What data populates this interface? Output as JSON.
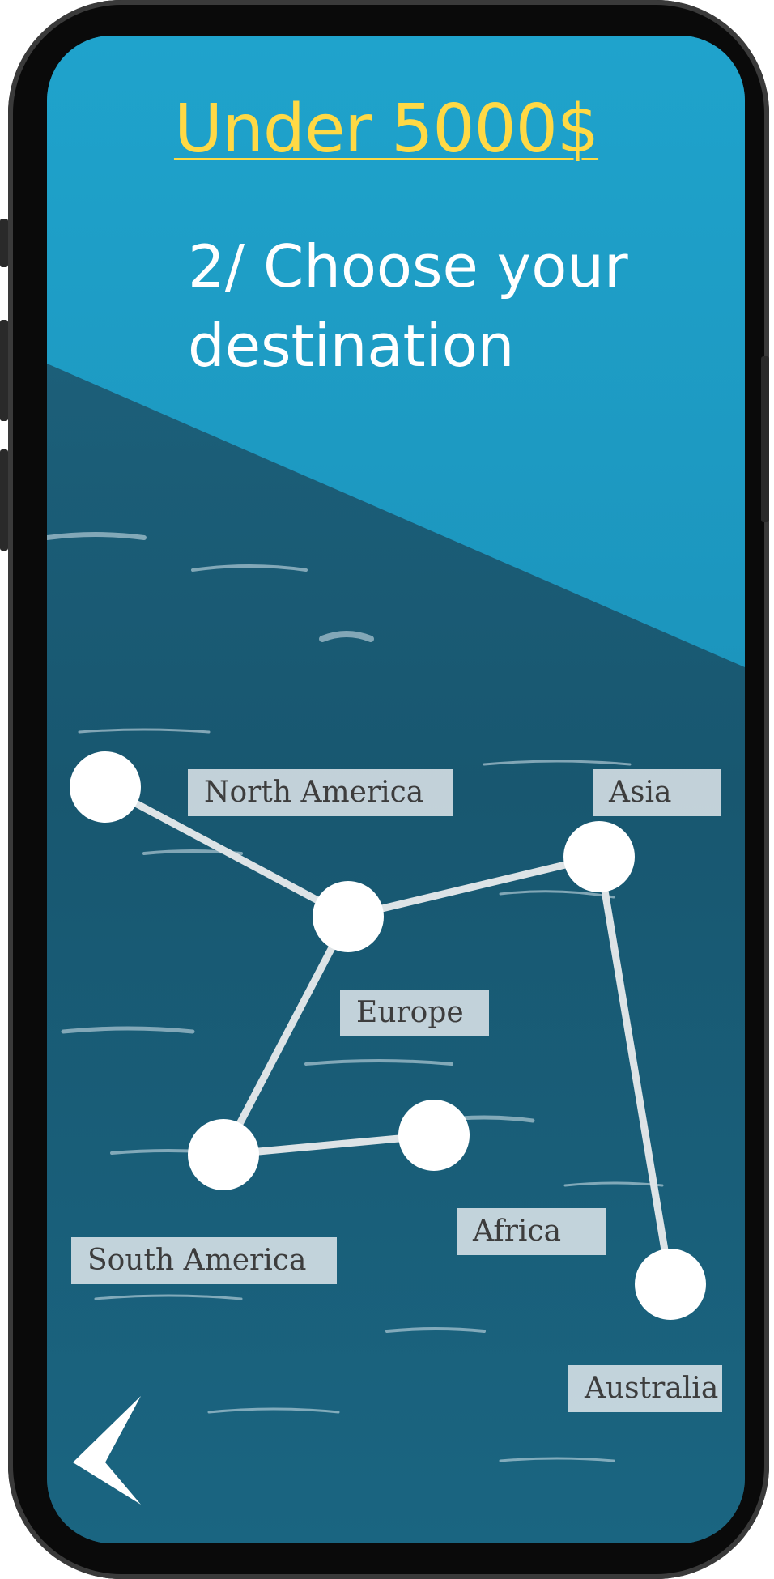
{
  "header": {
    "price_filter": "Under 5000$",
    "step_title": "2/ Choose your destination"
  },
  "destinations": [
    {
      "id": "north-america",
      "label": "North America"
    },
    {
      "id": "europe",
      "label": "Europe"
    },
    {
      "id": "asia",
      "label": "Asia"
    },
    {
      "id": "south-america",
      "label": "South America"
    },
    {
      "id": "africa",
      "label": "Africa"
    },
    {
      "id": "australia",
      "label": "Australia"
    }
  ],
  "connections": [
    [
      "north-america",
      "europe"
    ],
    [
      "europe",
      "asia"
    ],
    [
      "europe",
      "south-america"
    ],
    [
      "south-america",
      "africa"
    ],
    [
      "asia",
      "australia"
    ]
  ],
  "icons": {
    "back": "chevron-left-icon"
  },
  "colors": {
    "top_panel": "#1e9fc8",
    "sea": "#1b5a72",
    "price_filter": "#ffd945",
    "text": "#ffffff",
    "label_bg": "#e8edf0",
    "label_text": "#3d3d3d"
  }
}
